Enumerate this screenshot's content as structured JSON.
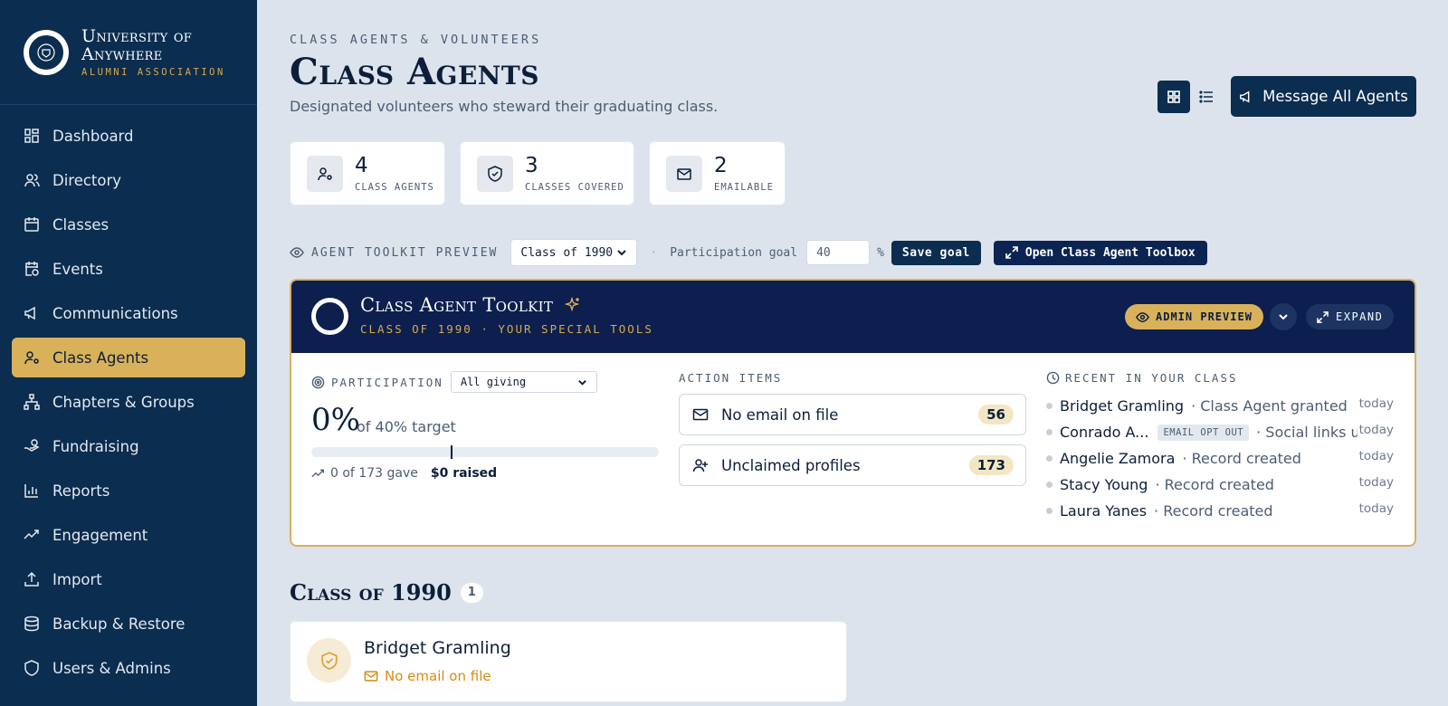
{
  "brand": {
    "name_line1": "University of",
    "name_line2": "Anywhere",
    "sub": "ALUMNI ASSOCIATION"
  },
  "nav": [
    {
      "label": "Dashboard",
      "icon": "dashboard-icon"
    },
    {
      "label": "Directory",
      "icon": "users-icon"
    },
    {
      "label": "Classes",
      "icon": "calendar-icon"
    },
    {
      "label": "Events",
      "icon": "calendar-clock-icon"
    },
    {
      "label": "Communications",
      "icon": "megaphone-icon"
    },
    {
      "label": "Class Agents",
      "icon": "user-cog-icon",
      "active": true
    },
    {
      "label": "Chapters & Groups",
      "icon": "network-icon"
    },
    {
      "label": "Fundraising",
      "icon": "hand-coins-icon"
    },
    {
      "label": "Reports",
      "icon": "bar-chart-icon"
    },
    {
      "label": "Engagement",
      "icon": "trending-up-icon"
    },
    {
      "label": "Import",
      "icon": "upload-icon"
    },
    {
      "label": "Backup & Restore",
      "icon": "database-icon"
    },
    {
      "label": "Users & Admins",
      "icon": "shield-icon"
    }
  ],
  "header": {
    "eyebrow": "CLASS AGENTS & VOLUNTEERS",
    "title": "Class Agents",
    "subtitle": "Designated volunteers who steward their graduating class.",
    "message_all": "Message All Agents"
  },
  "stats": [
    {
      "value": "4",
      "label": "CLASS AGENTS"
    },
    {
      "value": "3",
      "label": "CLASSES COVERED"
    },
    {
      "value": "2",
      "label": "EMAILABLE"
    }
  ],
  "toolbar": {
    "preview_label": "AGENT TOOLKIT PREVIEW",
    "class_select": "Class of 1990",
    "separator": "·",
    "goal_label": "Participation goal",
    "goal_value": "40",
    "percent": "%",
    "save_goal": "Save goal",
    "open_toolbox": "Open Class Agent Toolbox"
  },
  "toolkit": {
    "title": "Class Agent Toolkit",
    "subtitle": "CLASS OF 1990 · YOUR SPECIAL TOOLS",
    "admin_preview": "ADMIN PREVIEW",
    "expand": "EXPAND",
    "participation": {
      "label": "PARTICIPATION",
      "filter": "All giving",
      "percent": "0%",
      "target_text": "of 40% target",
      "progress": 0,
      "goal_marker": 0.4,
      "gave": "0 of 173 gave",
      "raised": "$0 raised"
    },
    "action_items": {
      "label": "ACTION ITEMS",
      "items": [
        {
          "label": "No email on file",
          "count": "56"
        },
        {
          "label": "Unclaimed profiles",
          "count": "173"
        }
      ]
    },
    "recent": {
      "label": "RECENT IN YOUR CLASS",
      "items": [
        {
          "name": "Bridget Gramling",
          "action": "· Class Agent granted",
          "time": "today"
        },
        {
          "name": "Conrado A...",
          "badge": "EMAIL OPT OUT",
          "action": "· Social links u...",
          "time": "today"
        },
        {
          "name": "Angelie Zamora",
          "action": "· Record created",
          "time": "today"
        },
        {
          "name": "Stacy Young",
          "action": "· Record created",
          "time": "today"
        },
        {
          "name": "Laura Yanes",
          "action": "· Record created",
          "time": "today"
        }
      ]
    }
  },
  "section": {
    "title": "Class of 1990",
    "count": "1",
    "agent": {
      "name": "Bridget Gramling",
      "email_status": "No email on file"
    }
  },
  "colors": {
    "navy": "#0b2d4f",
    "gold": "#d9b15b",
    "warning": "#d98a14",
    "bg": "#dde3ec"
  }
}
